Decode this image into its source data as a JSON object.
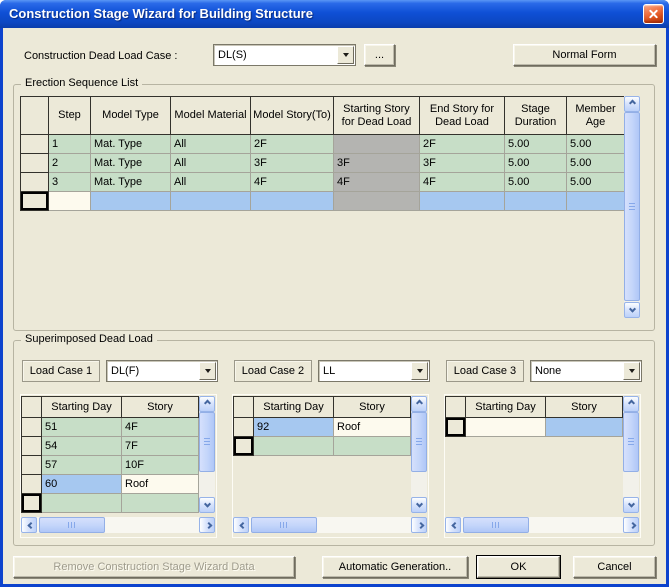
{
  "window": {
    "title": "Construction Stage Wizard for Building Structure"
  },
  "toolbar": {
    "dead_load_case_label": "Construction Dead Load Case :",
    "dead_load_case_value": "DL(S)",
    "browse_label": "...",
    "normal_form_label": "Normal Form"
  },
  "erection": {
    "group_label": "Erection Sequence List",
    "columns": [
      "Step",
      "Model Type",
      "Model Material",
      "Model Story(To)",
      "Starting Story for Dead Load",
      "End Story for Dead Load",
      "Stage Duration",
      "Member Age"
    ],
    "rows": [
      {
        "step": "1",
        "model_type": "Mat. Type",
        "model_material": "All",
        "model_story": "2F",
        "starting_story": "",
        "end_story": "2F",
        "stage_duration": "5.00",
        "member_age": "5.00"
      },
      {
        "step": "2",
        "model_type": "Mat. Type",
        "model_material": "All",
        "model_story": "3F",
        "starting_story": "3F",
        "end_story": "3F",
        "stage_duration": "5.00",
        "member_age": "5.00"
      },
      {
        "step": "3",
        "model_type": "Mat. Type",
        "model_material": "All",
        "model_story": "4F",
        "starting_story": "4F",
        "end_story": "4F",
        "stage_duration": "5.00",
        "member_age": "5.00"
      }
    ]
  },
  "superimposed": {
    "group_label": "Superimposed Dead Load",
    "columns": [
      "Starting Day",
      "Story"
    ],
    "panels": [
      {
        "label": "Load Case 1",
        "value": "DL(F)",
        "rows": [
          [
            "51",
            "4F"
          ],
          [
            "54",
            "7F"
          ],
          [
            "57",
            "10F"
          ],
          [
            "60",
            "Roof"
          ]
        ]
      },
      {
        "label": "Load Case 2",
        "value": "LL",
        "rows": [
          [
            "92",
            "Roof"
          ]
        ]
      },
      {
        "label": "Load Case 3",
        "value": "None",
        "rows": []
      }
    ]
  },
  "footer": {
    "remove_label": "Remove Construction Stage Wizard Data",
    "auto_label": "Automatic Generation..",
    "ok_label": "OK",
    "cancel_label": "Cancel"
  },
  "colors": {
    "dialog_bg": "#ece9d8",
    "titlebar_blue": "#0f50d6",
    "frame_blue": "#0d43cd",
    "close_red": "#d64c16",
    "cell_green": "#c7dec7",
    "cell_gray": "#b4b4b1",
    "cell_blue": "#a6c8f0",
    "cell_cream": "#fdfaee"
  }
}
